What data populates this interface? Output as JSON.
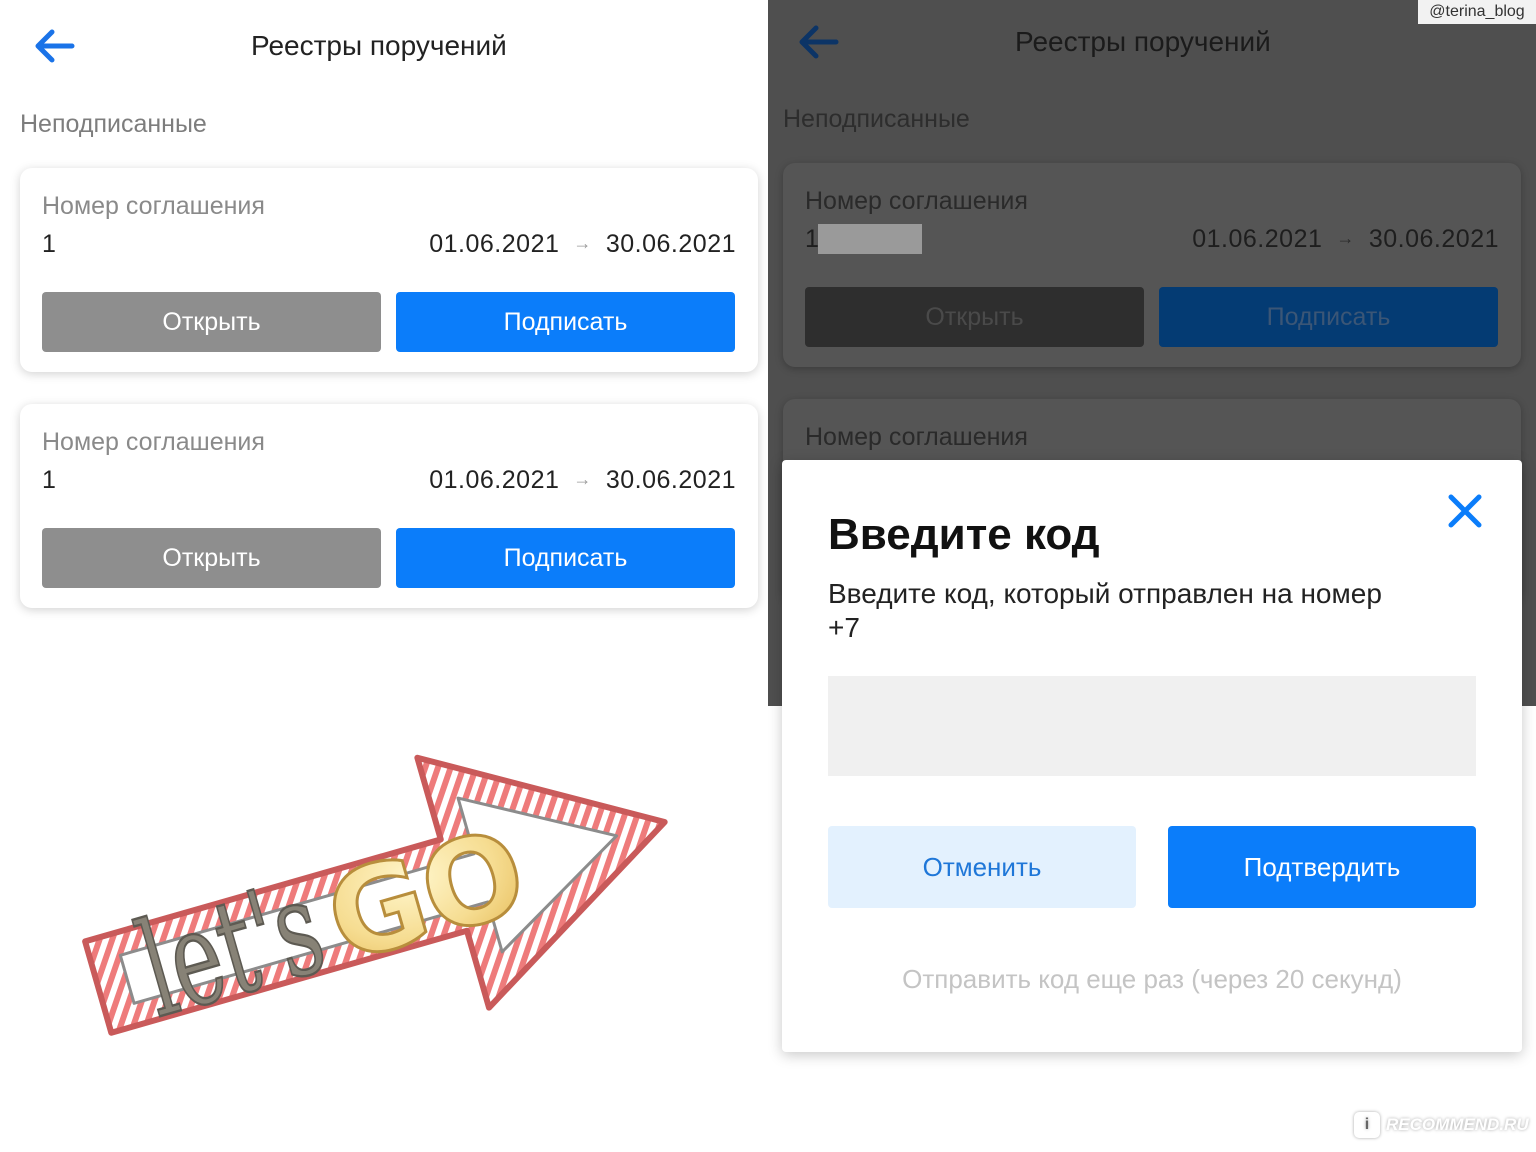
{
  "colors": {
    "accent": "#0b7dfa",
    "open_button": "#8e8e8e",
    "dim_overlay": "#4f4f4f",
    "cancel_bg": "#e3f1fe"
  },
  "left_screen": {
    "back_icon": "arrow-left-icon",
    "title": "Реестры поручений",
    "section": "Неподписанные",
    "cards": [
      {
        "label": "Номер соглашения",
        "number": "1",
        "date_from": "01.06.2021",
        "date_arrow": "→",
        "date_to": "30.06.2021",
        "open": "Открыть",
        "sign": "Подписать"
      },
      {
        "label": "Номер соглашения",
        "number": "1",
        "date_from": "01.06.2021",
        "date_arrow": "→",
        "date_to": "30.06.2021",
        "open": "Открыть",
        "sign": "Подписать"
      }
    ]
  },
  "right_screen": {
    "watermark": "@terina_blog",
    "title": "Реестры поручений",
    "section": "Неподписанные",
    "cards": [
      {
        "label": "Номер соглашения",
        "number": "1",
        "date_from": "01.06.2021",
        "date_arrow": "→",
        "date_to": "30.06.2021",
        "open": "Открыть",
        "sign": "Подписать"
      },
      {
        "label": "Номер соглашения"
      }
    ]
  },
  "dialog": {
    "close_icon": "close-x-icon",
    "title": "Введите код",
    "message": "Введите код, который отправлен на номер",
    "phone": "+7",
    "code_value": "",
    "cancel": "Отменить",
    "confirm": "Подтвердить",
    "resend": "Отправить код еще раз (через 20 секунд)"
  },
  "sticker": {
    "text_lets": "let's",
    "text_go": "GO"
  },
  "watermark_bottom": {
    "badge": "i",
    "text": "RECOMMEND.RU"
  }
}
